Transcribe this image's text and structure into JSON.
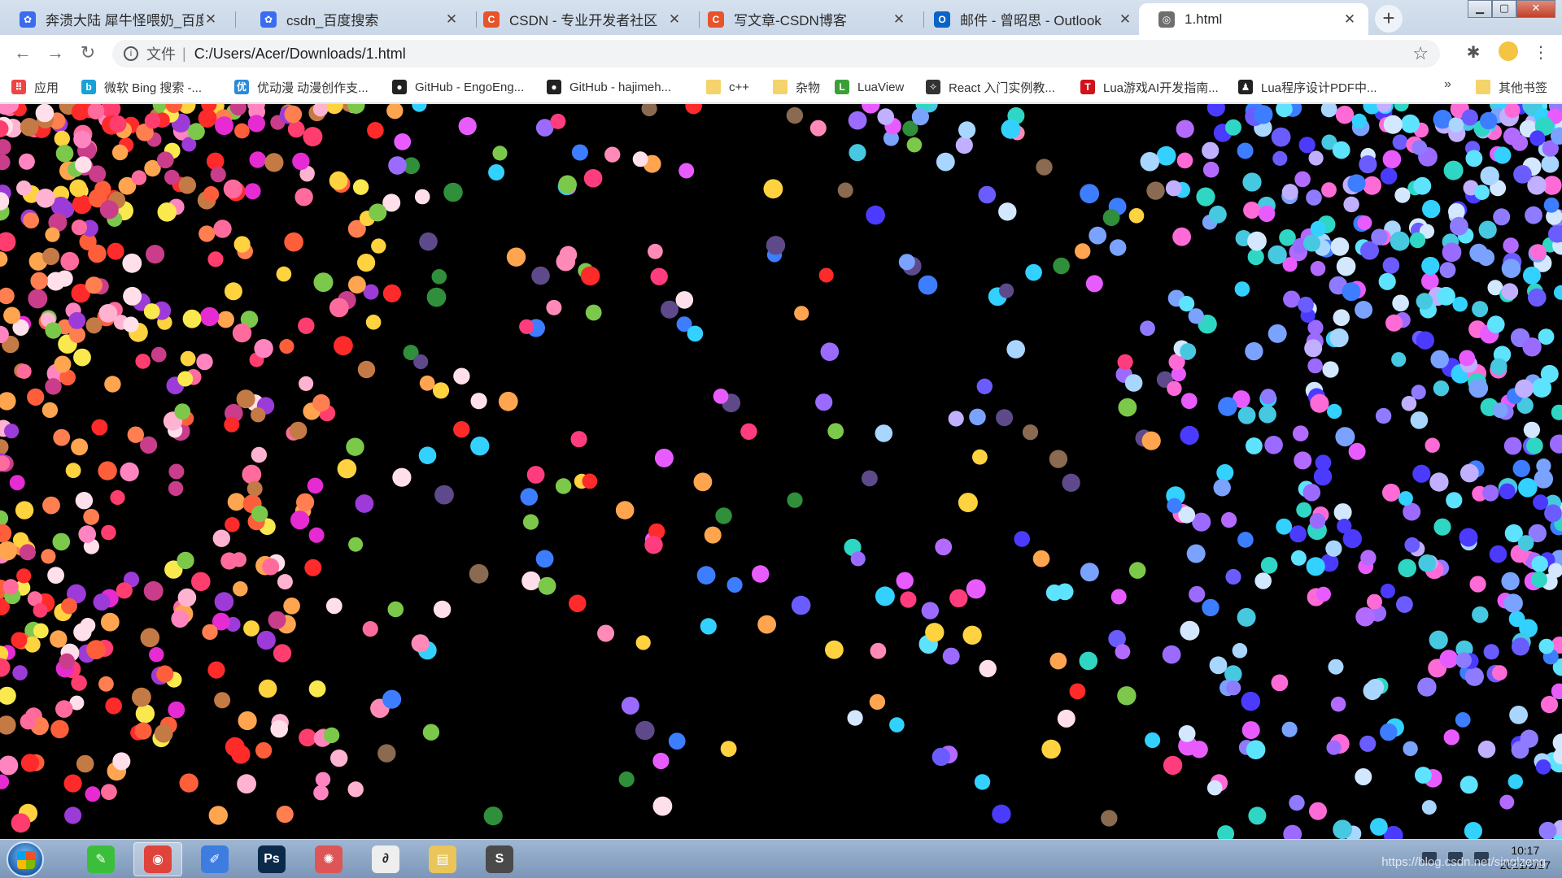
{
  "browser": {
    "tabs": [
      {
        "title": "奔溃大陆 犀牛怪喂奶_百度搜索",
        "favicon": "baidu-paw-icon",
        "color": "#3b6cf0",
        "glyph": "✿"
      },
      {
        "title": "csdn_百度搜索",
        "favicon": "baidu-paw-icon",
        "color": "#3b6cf0",
        "glyph": "✿"
      },
      {
        "title": "CSDN - 专业开发者社区",
        "favicon": "csdn-icon",
        "color": "#e8532c",
        "glyph": "C"
      },
      {
        "title": "写文章-CSDN博客",
        "favicon": "csdn-icon",
        "color": "#e8532c",
        "glyph": "C"
      },
      {
        "title": "邮件 - 曾昭思 - Outlook",
        "favicon": "outlook-icon",
        "color": "#0a64c8",
        "glyph": "O"
      },
      {
        "title": "1.html",
        "favicon": "globe-icon",
        "color": "#6f6f6f",
        "glyph": "◎"
      }
    ],
    "active_tab": 5,
    "tab_close_glyph": "✕",
    "new_tab_glyph": "+",
    "address": {
      "scheme_label": "文件",
      "url": "C:/Users/Acer/Downloads/1.html"
    },
    "nav": {
      "back": "←",
      "forward": "→",
      "reload": "↻"
    },
    "bookmarks": [
      {
        "label": "应用",
        "icon": "apps-grid-icon",
        "color": "#e44",
        "glyph": "⠿"
      },
      {
        "label": "微软 Bing 搜索 -...",
        "icon": "bing-icon",
        "color": "#1aa0d8",
        "glyph": "b"
      },
      {
        "label": "优动漫 动漫创作支...",
        "icon": "youdongman-icon",
        "color": "#2b8ad8",
        "glyph": "优"
      },
      {
        "label": "GitHub - EngoEng...",
        "icon": "github-icon",
        "color": "#222",
        "glyph": "●"
      },
      {
        "label": "GitHub - hajimeh...",
        "icon": "github-icon",
        "color": "#222",
        "glyph": "●"
      },
      {
        "label": "c++",
        "icon": "folder-icon",
        "color": "#f5d36b",
        "glyph": ""
      },
      {
        "label": "杂物",
        "icon": "folder-icon",
        "color": "#f5d36b",
        "glyph": ""
      },
      {
        "label": "LuaView",
        "icon": "luaview-icon",
        "color": "#3aa035",
        "glyph": "L"
      },
      {
        "label": "React 入门实例教...",
        "icon": "react-icon",
        "color": "#333",
        "glyph": "✧"
      },
      {
        "label": "Lua游戏AI开发指南...",
        "icon": "t-icon",
        "color": "#d0121b",
        "glyph": "T"
      },
      {
        "label": "Lua程序设计PDF中...",
        "icon": "penguin-icon",
        "color": "#222",
        "glyph": "♟"
      }
    ],
    "bookmarks_more": "»",
    "other_bookmarks": "其他书签"
  },
  "taskbar": {
    "apps": [
      {
        "name": "pen-app-icon",
        "color": "#3bbf3b",
        "glyph": "✎"
      },
      {
        "name": "chrome-icon",
        "color": "#e0433a",
        "glyph": "◉"
      },
      {
        "name": "editor-icon",
        "color": "#3d7de0",
        "glyph": "✐"
      },
      {
        "name": "photoshop-icon",
        "color": "#0b2a4a",
        "glyph": "Ps"
      },
      {
        "name": "color-wheel-icon",
        "color": "#d55",
        "glyph": "✺"
      },
      {
        "name": "clip-studio-icon",
        "color": "#eee",
        "glyph": "∂"
      },
      {
        "name": "file-explorer-icon",
        "color": "#e9c55a",
        "glyph": "▤"
      },
      {
        "name": "sublime-icon",
        "color": "#4a4a4a",
        "glyph": "S"
      }
    ],
    "clock_time": "10:17",
    "clock_date": "2021/2/17",
    "watermark": "https://blog.csdn.net/singlzeng"
  }
}
